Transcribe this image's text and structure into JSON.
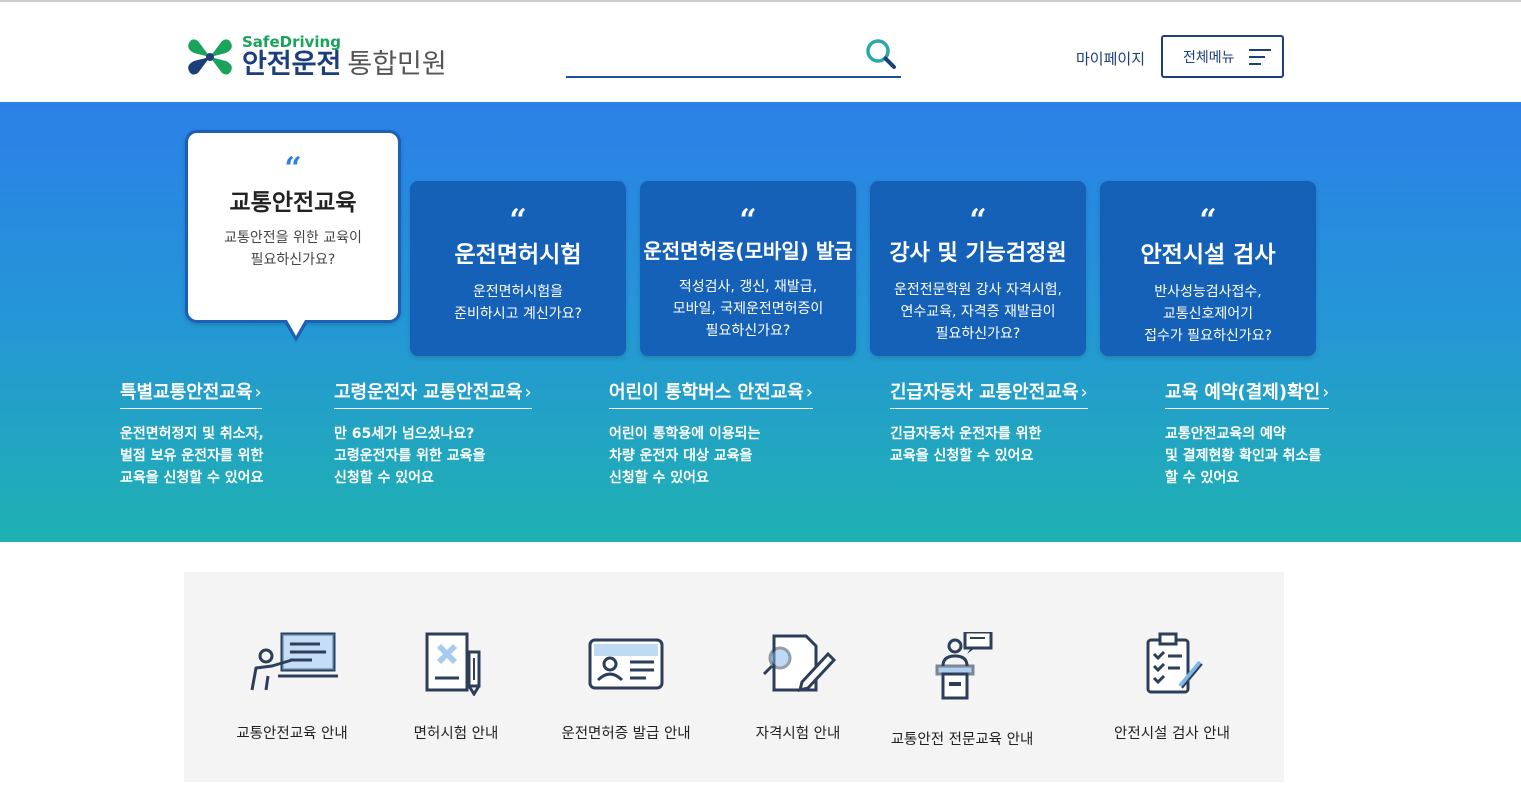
{
  "header": {
    "logo_sub": "SafeDriving",
    "logo_main": "안전운전",
    "logo_main_gray": "통합민원",
    "search_placeholder": "",
    "mypage": "마이페이지",
    "allmenu": "전체메뉴"
  },
  "cards": [
    {
      "title": "교통안전교육",
      "desc1": "교통안전을 위한 교육이",
      "desc2": "필요하신가요?",
      "desc3": "",
      "active": true
    },
    {
      "title": "운전면허시험",
      "desc1": "운전면허시험을",
      "desc2": "준비하시고 계신가요?",
      "desc3": ""
    },
    {
      "title": "운전면허증(모바일) 발급",
      "desc1": "적성검사, 갱신, 재발급,",
      "desc2": "모바일, 국제운전면허증이",
      "desc3": "필요하신가요?"
    },
    {
      "title": "강사 및 기능검정원",
      "desc1": "운전전문학원 강사 자격시험,",
      "desc2": "연수교육, 자격증 재발급이",
      "desc3": "필요하신가요?"
    },
    {
      "title": "안전시설 검사",
      "desc1": "반사성능검사접수,",
      "desc2": "교통신호제어기",
      "desc3": "접수가 필요하신가요?"
    }
  ],
  "quote_mark": "“",
  "sublinks": [
    {
      "title": "특별교통안전교육",
      "d1": "운전면허정지 및 취소자,",
      "d2": "벌점 보유 운전자를 위한",
      "d3": "교육을 신청할 수 있어요"
    },
    {
      "title": "고령운전자 교통안전교육",
      "d1": "만 65세가 넘으셨나요?",
      "d2": "고령운전자를 위한 교육을",
      "d3": "신청할 수 있어요"
    },
    {
      "title": "어린이 통학버스 안전교육",
      "d1": "어린이 통학용에 이용되는",
      "d2": "차량 운전자 대상 교육을",
      "d3": "신청할 수 있어요"
    },
    {
      "title": "긴급자동차 교통안전교육",
      "d1": "긴급자동차 운전자를 위한",
      "d2": "교육을 신청할 수 있어요",
      "d3": ""
    },
    {
      "title": "교육 예약(결제)확인",
      "d1": "교통안전교육의 예약",
      "d2": "및 결제현황 확인과 취소를",
      "d3": "할 수 있어요"
    }
  ],
  "arrow": "›",
  "guide": [
    {
      "label": "교통안전교육 안내",
      "icon": "teacher-board-icon"
    },
    {
      "label": "면허시험 안내",
      "icon": "license-document-icon"
    },
    {
      "label": "운전면허증 발급 안내",
      "icon": "id-card-icon"
    },
    {
      "label": "자격시험 안내",
      "icon": "exam-paper-icon"
    },
    {
      "label": "교통안전 전문교육 안내",
      "icon": "lecturer-podium-icon"
    },
    {
      "label": "안전시설 검사 안내",
      "icon": "clipboard-checklist-icon"
    }
  ],
  "colors": {
    "brand_navy": "#1c3e7a",
    "brand_green": "#1aa35a",
    "card_blue": "#1561b8",
    "accent": "#2b80e6"
  }
}
